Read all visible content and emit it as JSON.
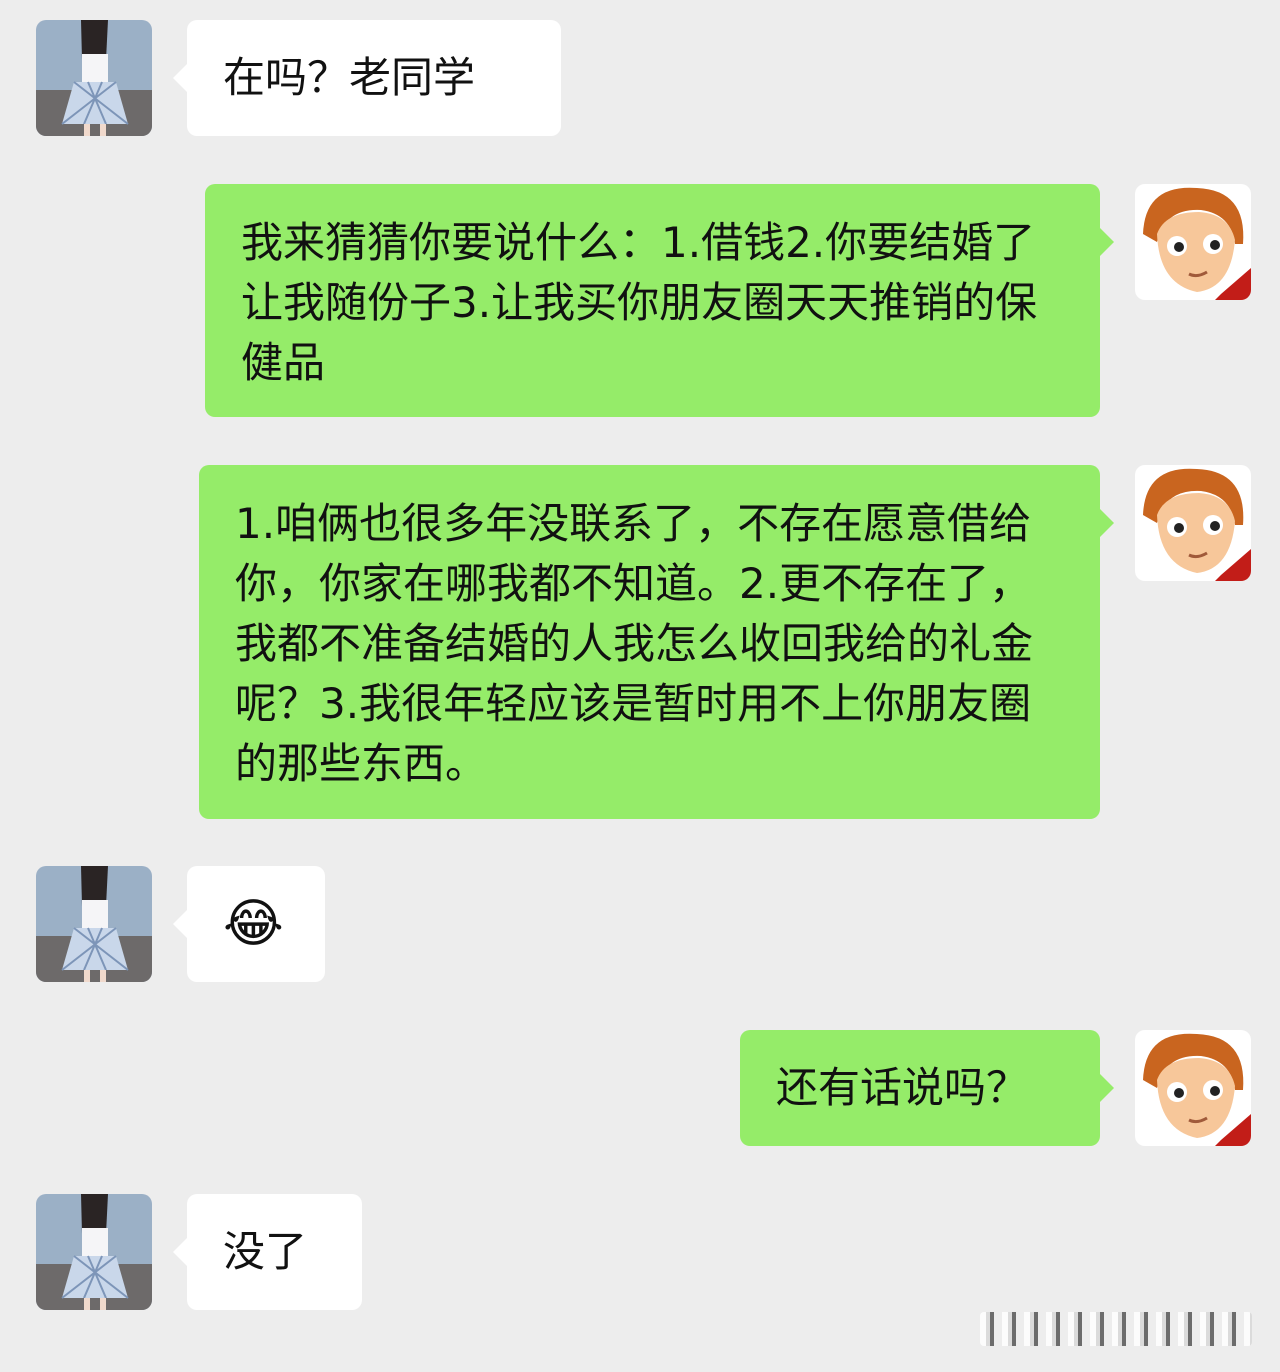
{
  "messages": [
    {
      "side": "in",
      "text": "在吗？老同学"
    },
    {
      "side": "out",
      "text": "我来猜猜你要说什么：1.借钱2.你要结婚了让我随份子3.让我买你朋友圈天天推销的保健品"
    },
    {
      "side": "out",
      "text": "1.咱俩也很多年没联系了，不存在愿意借给你，你家在哪我都不知道。2.更不存在了，我都不准备结婚的人我怎么收回我给的礼金呢？3.我很年轻应该是暂时用不上你朋友圈的那些东西。"
    },
    {
      "side": "in",
      "text": "😂"
    },
    {
      "side": "out",
      "text": "还有话说吗？"
    },
    {
      "side": "in",
      "text": "没了"
    }
  ],
  "colors": {
    "background": "#ededed",
    "incoming_bubble": "#ffffff",
    "outgoing_bubble": "#95ec69"
  },
  "icons": {
    "incoming_avatar": "girl-photo-avatar",
    "outgoing_avatar": "cartoon-boy-avatar"
  }
}
